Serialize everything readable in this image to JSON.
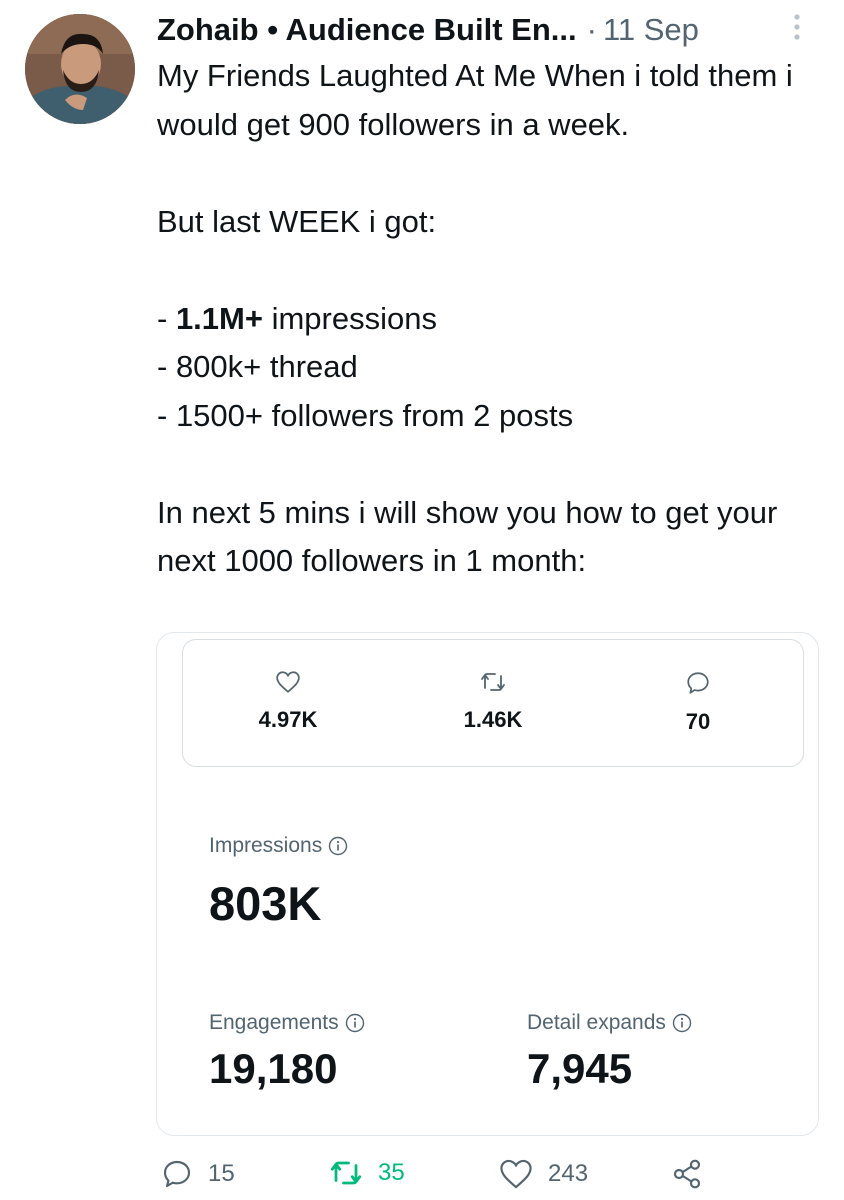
{
  "tweet": {
    "author": "Zohaib • Audience Built En...",
    "separator": "·",
    "time": "11 Sep",
    "text": {
      "intro": "My Friends Laughted At Me When i told them i would get 900 followers in a week.",
      "but": "But last WEEK i got:",
      "list": [
        {
          "prefix": "- ",
          "bold": "1.1M+",
          "rest": " impressions"
        },
        {
          "prefix": "- ",
          "bold": "",
          "rest": "800k+ thread"
        },
        {
          "prefix": "- ",
          "bold": "",
          "rest": "1500+ followers from 2 posts"
        }
      ],
      "outro": "In next 5 mins i will show you how to get your next 1000 followers in 1 month:"
    }
  },
  "card": {
    "stats": {
      "likes": "4.97K",
      "retweets": "1.46K",
      "replies": "70"
    },
    "impressions": {
      "label": "Impressions",
      "value": "803K"
    },
    "engagements": {
      "label": "Engagements",
      "value": "19,180"
    },
    "detail_expands": {
      "label": "Detail expands",
      "value": "7,945"
    }
  },
  "actions": {
    "replies": "15",
    "retweets": "35",
    "likes": "243"
  },
  "colors": {
    "text": "#0f1419",
    "secondary": "#536471",
    "retweet_green": "#00ba7c"
  },
  "icons": [
    "more-icon",
    "heart-icon",
    "retweet-icon",
    "reply-icon",
    "info-icon",
    "share-icon"
  ]
}
